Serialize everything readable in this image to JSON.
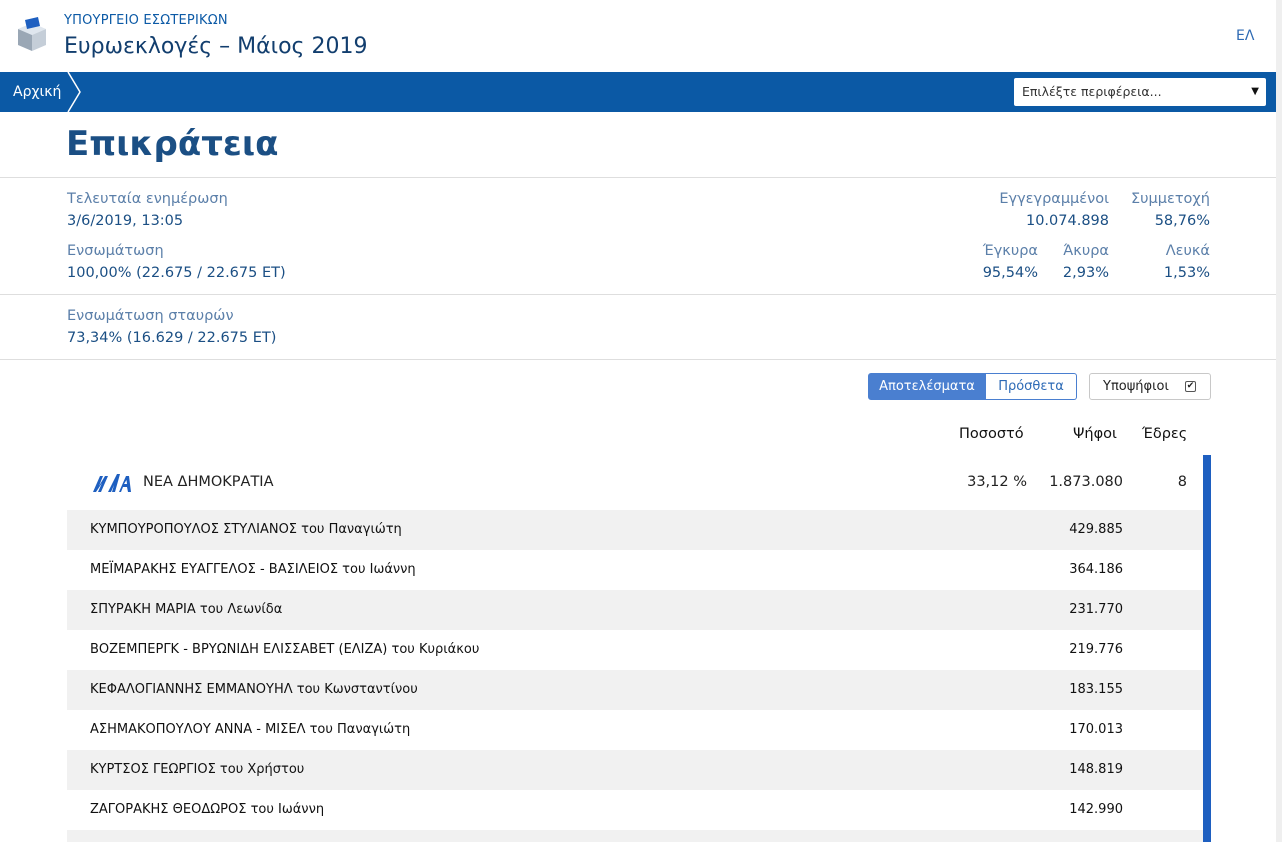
{
  "header": {
    "ministry": "ΥΠΟΥΡΓΕΙΟ ΕΣΩΤΕΡΙΚΩΝ",
    "title": "Ευρωεκλογές – Μάιος 2019",
    "lang": "ΕΛ",
    "logo_icon": "ballot-box-icon"
  },
  "nav": {
    "breadcrumb": "Αρχική",
    "region_placeholder": "Επιλέξτε περιφέρεια...",
    "caret": "▼"
  },
  "page": {
    "heading": "Επικράτεια"
  },
  "stats": {
    "last_update_label": "Τελευταία ενημέρωση",
    "last_update_value": "3/6/2019, 13:05",
    "integration_label": "Ενσωμάτωση",
    "integration_value": "100,00% (22.675 / 22.675 ΕΤ)",
    "registered_label": "Εγγεγραμμένοι",
    "registered_value": "10.074.898",
    "turnout_label": "Συμμετοχή",
    "turnout_value": "58,76%",
    "valid_label": "Έγκυρα",
    "valid_value": "95,54%",
    "invalid_label": "Άκυρα",
    "invalid_value": "2,93%",
    "blank_label": "Λευκά",
    "blank_value": "1,53%",
    "cross_label": "Ενσωμάτωση σταυρών",
    "cross_value": "73,34% (16.629 / 22.675 ΕΤ)"
  },
  "controls": {
    "results_label": "Αποτελέσματα",
    "extra_label": "Πρόσθετα",
    "candidates_label": "Υποψήφιοι",
    "candidates_checked": "✔"
  },
  "table": {
    "col_percent": "Ποσοστό",
    "col_votes": "Ψήφοι",
    "col_seats": "Έδρες"
  },
  "party": {
    "name": "ΝΕΑ ΔΗΜΟΚΡΑΤΙΑ",
    "percent": "33,12 %",
    "votes": "1.873.080",
    "seats": "8",
    "color": "#1e5fc0"
  },
  "candidates": [
    {
      "name": "ΚΥΜΠΟΥΡΟΠΟΥΛΟΣ ΣΤΥΛΙΑΝΟΣ του Παναγιώτη",
      "votes": "429.885"
    },
    {
      "name": "ΜΕΪΜΑΡΑΚΗΣ ΕΥΑΓΓΕΛΟΣ - ΒΑΣΙΛΕΙΟΣ του Ιωάννη",
      "votes": "364.186"
    },
    {
      "name": "ΣΠΥΡΑΚΗ ΜΑΡΙΑ του Λεωνίδα",
      "votes": "231.770"
    },
    {
      "name": "ΒΟΖΕΜΠΕΡΓΚ - ΒΡΥΩΝΙΔΗ ΕΛΙΣΣΑΒΕΤ (ΕΛΙΖΑ) του Κυριάκου",
      "votes": "219.776"
    },
    {
      "name": "ΚΕΦΑΛΟΓΙΑΝΝΗΣ ΕΜΜΑΝΟΥΗΛ του Κωνσταντίνου",
      "votes": "183.155"
    },
    {
      "name": "ΑΣΗΜΑΚΟΠΟΥΛΟΥ ΑΝΝΑ - ΜΙΣΕΛ του Παναγιώτη",
      "votes": "170.013"
    },
    {
      "name": "ΚΥΡΤΣΟΣ ΓΕΩΡΓΙΟΣ του Χρήστου",
      "votes": "148.819"
    },
    {
      "name": "ΖΑΓΟΡΑΚΗΣ ΘΕΟΔΩΡΟΣ του Ιωάννη",
      "votes": "142.990"
    },
    {
      "name": "",
      "votes": ""
    }
  ]
}
